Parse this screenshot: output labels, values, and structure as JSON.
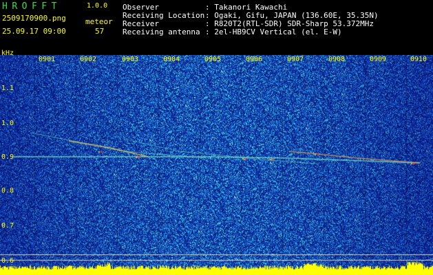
{
  "app": {
    "title": "HROFFT",
    "version": "1.0.0"
  },
  "file": {
    "name": "2509170900.png",
    "datetime": "25.09.17 09:00"
  },
  "meteor": {
    "label": "meteor",
    "count": "57"
  },
  "info": [
    {
      "key": "Observer",
      "value": ": Takanori Kawachi"
    },
    {
      "key": "Receiving Location",
      "value": ": Ogaki, Gifu, JAPAN (136.60E, 35.35N)"
    },
    {
      "key": "Receiver",
      "value": ": R820T2(RTL-SDR) SDR-Sharp 53.372MHz"
    },
    {
      "key": "Receiving antenna",
      "value": ": 2el-HB9CV Vertical (el. E-W)"
    }
  ],
  "axis": {
    "y_unit": "kHz",
    "y_ticks": [
      "1.1",
      "1.0",
      "0.9",
      "0.8",
      "0.7",
      "0.6"
    ],
    "x_ticks": [
      "0901",
      "0902",
      "0903",
      "0904",
      "0905",
      "0906",
      "0907",
      "0908",
      "0909",
      "0910"
    ]
  },
  "colors": {
    "background": "#000000",
    "label_yellow": "#ffff00",
    "title_green": "#3cdc4c",
    "text_white": "#ffffff",
    "spectrum_base": "#0a1a9c"
  }
}
